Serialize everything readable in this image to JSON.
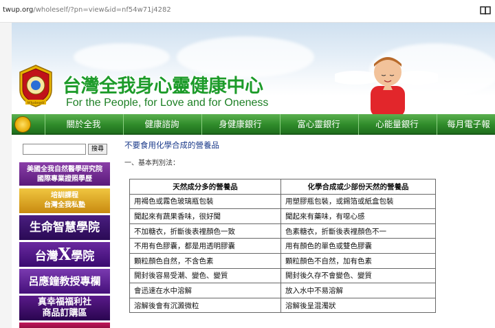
{
  "browser": {
    "url_domain": "twup.org",
    "url_path": "/wholeself/?pn=view&id=nf54w71j4282",
    "reader_icon": "book-icon"
  },
  "header": {
    "site_title": "台灣全我身心靈健康中心",
    "tagline": "For the People, for Love and for Oneness",
    "emblem_caption": "Wholeself"
  },
  "nav": {
    "home_icon": "emblem-icon",
    "items": [
      "關於全我",
      "健康諮詢",
      "身健康銀行",
      "富心靈銀行",
      "心能量銀行",
      "每月電子報"
    ]
  },
  "sidebar": {
    "search_placeholder": "",
    "search_button": "搜尋",
    "banners": [
      {
        "line1": "美國全我自然醫學研究院",
        "line2": "國際專業證照學歷"
      },
      {
        "line1": "培訓課程",
        "line2": "台灣全我私塾"
      },
      {
        "line1": "生命智慧學院",
        "line2": ""
      },
      {
        "line1": "台灣",
        "x": "X",
        "line2": "學院"
      },
      {
        "line1": "呂應鐘教授專欄",
        "line2": ""
      },
      {
        "line1": "真幸福福利社",
        "line2": "商品訂購區"
      }
    ]
  },
  "content": {
    "title": "不要食用化學合成的營養品",
    "subtitle": "一、基本判別法：",
    "table": {
      "headers": [
        "天然成分多的營養品",
        "化學合成或少部份天然的營養品"
      ],
      "rows": [
        [
          "用褐色或霧色玻璃瓶包裝",
          "用塑膠瓶包裝，或錫箔或紙盒包裝"
        ],
        [
          "聞起來有蔬果香味，很好聞",
          "聞起來有藥味，有噁心感"
        ],
        [
          "不加糖衣，折斷後表裡顏色一致",
          "色素糖衣，折斷後表裡顏色不一"
        ],
        [
          "不用有色膠囊，都是用透明膠囊",
          "用有顏色的單色或雙色膠囊"
        ],
        [
          "顆粒顏色自然，不含色素",
          "顆粒顏色不自然，加有色素"
        ],
        [
          "開封後容易受潮、變色、變質",
          "開封後久存不會變色、變質"
        ],
        [
          "會迅速在水中溶解",
          "放入水中不易溶解"
        ],
        [
          "溶解後會有沉澱微粒",
          "溶解後呈混濁狀"
        ]
      ]
    }
  },
  "colors": {
    "nav_green": "#2f8b2a",
    "title_green": "#1d9b2a",
    "content_title_blue": "#1a3a8a"
  }
}
